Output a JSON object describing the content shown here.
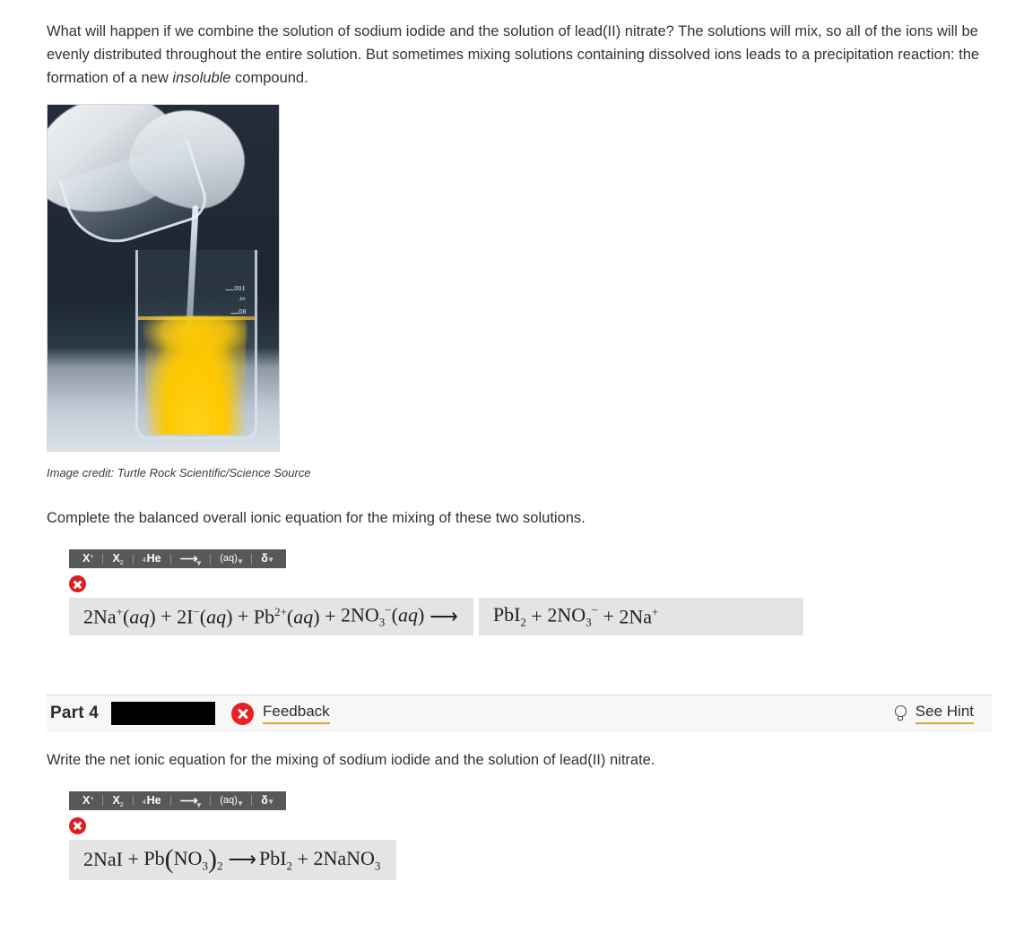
{
  "intro": {
    "text_part1": "What will happen if we combine the solution of sodium iodide and the solution of lead(II) nitrate? The solutions will mix, so all of the ions will be evenly distributed throughout the entire solution. But sometimes mixing solutions containing dissolved ions leads to a precipitation reaction: the formation of a new ",
    "emphasis": "insoluble",
    "text_part2": " compound."
  },
  "figure": {
    "alt": "Gloved hand pouring clear solution into a beaker forming bright yellow lead(II) iodide precipitate",
    "graduation_100": "100",
    "graduation_mid": "mL",
    "graduation_80": "80",
    "caption": "Image credit: Turtle Rock Scientific/Science Source"
  },
  "part3": {
    "prompt": "Complete the balanced overall ionic equation for the mixing of these two solutions.",
    "toolbar": {
      "superscript": "X",
      "superscript_mark": "+",
      "subscript": "X",
      "subscript_mark": "2",
      "isotope_pre": "4",
      "isotope": "He",
      "arrow": "⟶",
      "arrow_mark": "▾",
      "state": "(aq)",
      "state_mark": "▾",
      "delta": "δ",
      "delta_mark": "▾"
    },
    "status": "incorrect",
    "given_equation": {
      "terms": [
        {
          "coef": "2",
          "formula": "Na",
          "sup": "+",
          "state": "(aq)"
        },
        {
          "coef": "2",
          "formula": "I",
          "sup": "−",
          "state": "(aq)"
        },
        {
          "coef": "",
          "formula": "Pb",
          "sup": "2+",
          "state": "(aq)"
        },
        {
          "coef": "2",
          "formula": "NO",
          "sub": "3",
          "sup": "−",
          "state": "(aq)"
        }
      ],
      "arrow": "⟶"
    },
    "answer_equation": {
      "terms": [
        {
          "coef": "",
          "formula": "PbI",
          "sub": "2",
          "sup": ""
        },
        {
          "coef": "2",
          "formula": "NO",
          "sub": "3",
          "sup": "−"
        },
        {
          "coef": "2",
          "formula": "Na",
          "sub": "",
          "sup": "+"
        }
      ]
    }
  },
  "part4": {
    "label": "Part 4",
    "redacted_value": "",
    "feedback_label": "Feedback",
    "hint_label": "See Hint",
    "status": "incorrect",
    "prompt": "Write the net ionic equation for the mixing of sodium iodide and the solution of lead(II) nitrate.",
    "toolbar": {
      "superscript": "X",
      "superscript_mark": "+",
      "subscript": "X",
      "subscript_mark": "2",
      "isotope_pre": "4",
      "isotope": "He",
      "arrow": "⟶",
      "arrow_mark": "▾",
      "state": "(aq)",
      "state_mark": "▾",
      "delta": "δ",
      "delta_mark": "▾"
    },
    "answer_equation": {
      "reactants": [
        {
          "coef": "2",
          "formula": "NaI"
        },
        {
          "coef": "",
          "formula": "Pb",
          "group": "NO",
          "group_sub": "3",
          "group_count": "2"
        }
      ],
      "arrow": "⟶",
      "products": [
        {
          "coef": "",
          "formula": "PbI",
          "sub": "2"
        },
        {
          "coef": "2",
          "formula": "NaNO",
          "sub": "3"
        }
      ]
    }
  },
  "colors": {
    "error_red": "#e01b22",
    "link_underline": "#d8a531",
    "toolbar_bg": "#585858",
    "input_bg": "#e4e4e4",
    "part_bar_bg": "#f7f7f7",
    "precipitate_yellow": "#fdc800"
  }
}
